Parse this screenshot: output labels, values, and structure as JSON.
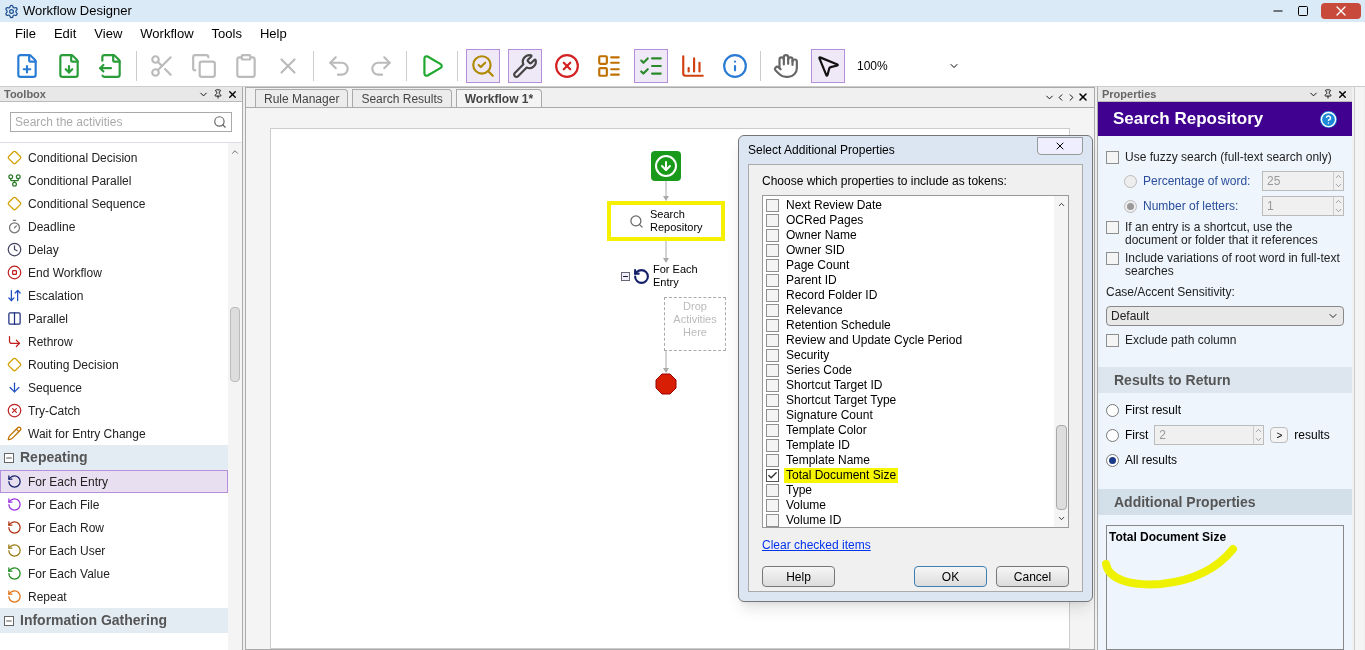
{
  "window": {
    "title": "Workflow Designer"
  },
  "menu": [
    "File",
    "Edit",
    "View",
    "Workflow",
    "Tools",
    "Help"
  ],
  "toolbar": {
    "buttons": [
      {
        "selected": false,
        "disabled": false
      },
      {
        "selected": false,
        "disabled": false
      },
      {
        "selected": false,
        "disabled": false
      },
      {
        "selected": false,
        "disabled": true
      },
      {
        "selected": false,
        "disabled": true
      },
      {
        "selected": false,
        "disabled": true
      },
      {
        "selected": false,
        "disabled": true
      },
      {
        "selected": false,
        "disabled": true
      },
      {
        "selected": false,
        "disabled": true
      },
      {
        "selected": false,
        "disabled": false
      },
      {
        "selected": true,
        "disabled": false
      },
      {
        "selected": true,
        "disabled": false
      },
      {
        "selected": false,
        "disabled": false
      },
      {
        "selected": false,
        "disabled": false
      },
      {
        "selected": true,
        "disabled": false
      },
      {
        "selected": false,
        "disabled": false
      },
      {
        "selected": false,
        "disabled": false
      },
      {
        "selected": false,
        "disabled": false
      },
      {
        "selected": true,
        "disabled": false
      }
    ],
    "zoom": "100%"
  },
  "toolbox": {
    "title": "Toolbox",
    "search_placeholder": "Search the activities",
    "items": [
      {
        "label": "Conditional Decision",
        "selected": false
      },
      {
        "label": "Conditional Parallel",
        "selected": false
      },
      {
        "label": "Conditional Sequence",
        "selected": false
      },
      {
        "label": "Deadline",
        "selected": false
      },
      {
        "label": "Delay",
        "selected": false
      },
      {
        "label": "End Workflow",
        "selected": false
      },
      {
        "label": "Escalation",
        "selected": false
      },
      {
        "label": "Parallel",
        "selected": false
      },
      {
        "label": "Rethrow",
        "selected": false
      },
      {
        "label": "Routing Decision",
        "selected": false
      },
      {
        "label": "Sequence",
        "selected": false
      },
      {
        "label": "Try-Catch",
        "selected": false
      },
      {
        "label": "Wait for Entry Change",
        "selected": false
      }
    ],
    "groups": [
      {
        "name": "Repeating",
        "expanded": true,
        "items": [
          {
            "label": "For Each Entry",
            "selected": true
          },
          {
            "label": "For Each File",
            "selected": false
          },
          {
            "label": "For Each Row",
            "selected": false
          },
          {
            "label": "For Each User",
            "selected": false
          },
          {
            "label": "For Each Value",
            "selected": false
          },
          {
            "label": "Repeat",
            "selected": false
          }
        ]
      },
      {
        "name": "Information Gathering",
        "expanded": true
      }
    ]
  },
  "tabs": [
    {
      "label": "Rule Manager",
      "selected": false
    },
    {
      "label": "Search Results",
      "selected": false
    },
    {
      "label": "Workflow 1*",
      "selected": true
    }
  ],
  "canvas": {
    "activity": {
      "label": "Search Repository",
      "selected": true
    },
    "loop": {
      "label": "For Each Entry",
      "expanded": true
    },
    "drop_hint": "Drop Activities Here"
  },
  "dialog": {
    "title": "Select Additional Properties",
    "prompt": "Choose which properties to include as tokens:",
    "options": [
      {
        "label": "Next Review Date",
        "checked": false,
        "highlighted": false
      },
      {
        "label": "OCRed Pages",
        "checked": false,
        "highlighted": false
      },
      {
        "label": "Owner Name",
        "checked": false,
        "highlighted": false
      },
      {
        "label": "Owner SID",
        "checked": false,
        "highlighted": false
      },
      {
        "label": "Page Count",
        "checked": false,
        "highlighted": false
      },
      {
        "label": "Parent ID",
        "checked": false,
        "highlighted": false
      },
      {
        "label": "Record Folder ID",
        "checked": false,
        "highlighted": false
      },
      {
        "label": "Relevance",
        "checked": false,
        "highlighted": false
      },
      {
        "label": "Retention Schedule",
        "checked": false,
        "highlighted": false
      },
      {
        "label": "Review and Update Cycle Period",
        "checked": false,
        "highlighted": false
      },
      {
        "label": "Security",
        "checked": false,
        "highlighted": false
      },
      {
        "label": "Series Code",
        "checked": false,
        "highlighted": false
      },
      {
        "label": "Shortcut Target ID",
        "checked": false,
        "highlighted": false
      },
      {
        "label": "Shortcut Target Type",
        "checked": false,
        "highlighted": false
      },
      {
        "label": "Signature Count",
        "checked": false,
        "highlighted": false
      },
      {
        "label": "Template Color",
        "checked": false,
        "highlighted": false
      },
      {
        "label": "Template ID",
        "checked": false,
        "highlighted": false
      },
      {
        "label": "Template Name",
        "checked": false,
        "highlighted": false
      },
      {
        "label": "Total Document Size",
        "checked": true,
        "highlighted": true
      },
      {
        "label": "Type",
        "checked": false,
        "highlighted": false
      },
      {
        "label": "Volume",
        "checked": false,
        "highlighted": false
      },
      {
        "label": "Volume ID",
        "checked": false,
        "highlighted": false
      }
    ],
    "link": "Clear checked items",
    "buttons": [
      {
        "label": "Help",
        "default": false
      },
      {
        "label": "OK",
        "default": true
      },
      {
        "label": "Cancel",
        "default": false
      }
    ]
  },
  "properties": {
    "title": "Properties",
    "heading": "Search Repository",
    "fuzzy": {
      "label": "Use fuzzy search (full-text search only)",
      "checked": false
    },
    "fuzzy_modes": [
      {
        "label": "Percentage of word:",
        "selected": false,
        "value": "25"
      },
      {
        "label": "Number of letters:",
        "selected": true,
        "value": "1"
      }
    ],
    "options": [
      {
        "label": "If an entry is a shortcut, use the document or folder that it references",
        "checked": false
      },
      {
        "label": "Include variations of root word in full-text searches",
        "checked": false
      }
    ],
    "sensitivity": {
      "label": "Case/Accent Sensitivity:",
      "value": "Default"
    },
    "exclude": {
      "label": "Exclude path column",
      "checked": false
    },
    "results": {
      "heading": "Results to Return",
      "first_result": {
        "label": "First result",
        "selected": false
      },
      "first": {
        "label": "First",
        "selected": false,
        "value": "2",
        "button": ">",
        "suffix": "results"
      },
      "all": {
        "label": "All results",
        "selected": true
      }
    },
    "additional": {
      "heading": "Additional Properties",
      "items": [
        "Total Document Size"
      ],
      "circled": true
    }
  }
}
